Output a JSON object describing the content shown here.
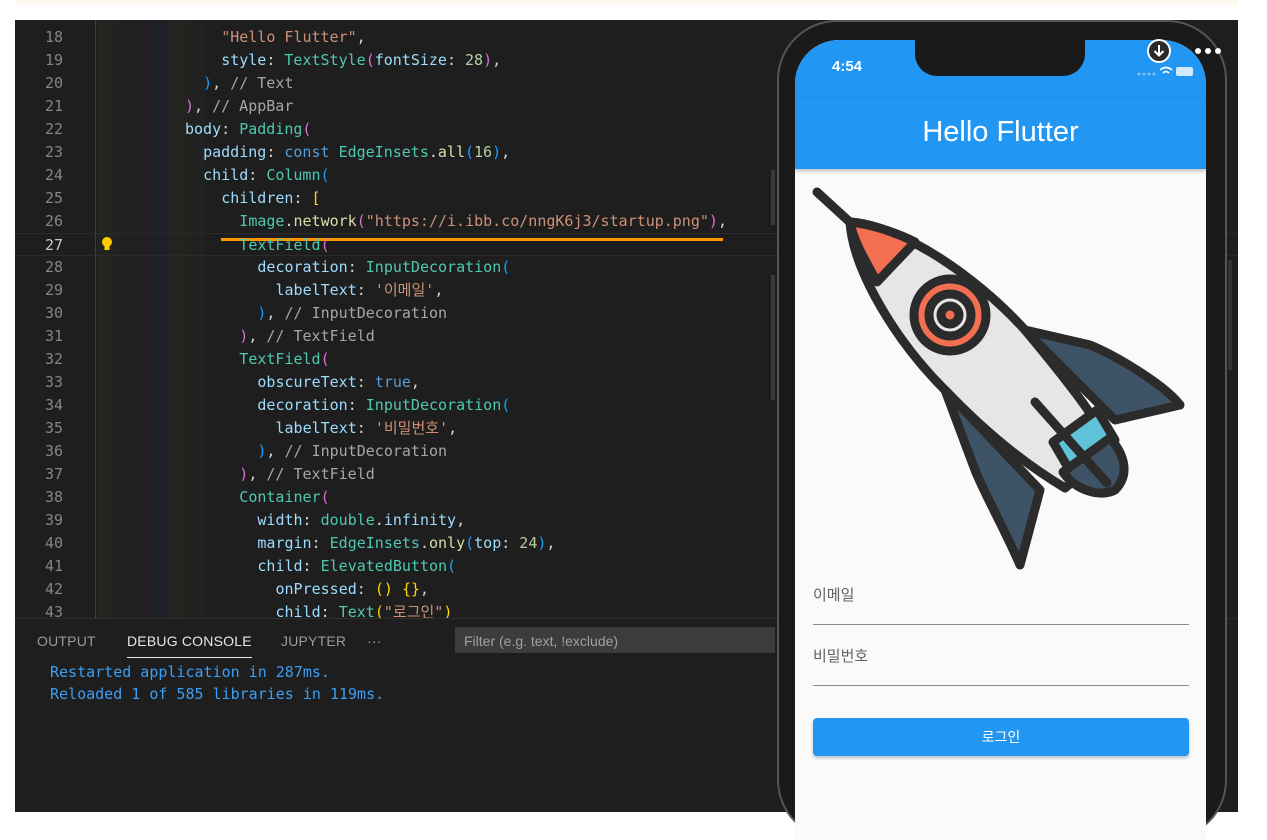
{
  "code_lines": [
    {
      "n": "18",
      "indent": 10,
      "tokens": [
        [
          "\"Hello Flutter\"",
          "c-str"
        ],
        [
          ",",
          "c-def"
        ]
      ]
    },
    {
      "n": "19",
      "indent": 10,
      "tokens": [
        [
          "style",
          "c-prop"
        ],
        [
          ": ",
          "c-def"
        ],
        [
          "TextStyle",
          "c-cls"
        ],
        [
          "(",
          "c-p1"
        ],
        [
          "fontSize",
          "c-prop"
        ],
        [
          ": ",
          "c-def"
        ],
        [
          "28",
          "c-num"
        ],
        [
          ")",
          "c-p1"
        ],
        [
          ",",
          "c-def"
        ]
      ]
    },
    {
      "n": "20",
      "indent": 9,
      "tokens": [
        [
          ")",
          "c-p2"
        ],
        [
          ", ",
          "c-def"
        ],
        [
          "// Text",
          "c-com"
        ]
      ]
    },
    {
      "n": "21",
      "indent": 8,
      "tokens": [
        [
          ")",
          "c-p1"
        ],
        [
          ", ",
          "c-def"
        ],
        [
          "// AppBar",
          "c-com"
        ]
      ]
    },
    {
      "n": "22",
      "indent": 8,
      "tokens": [
        [
          "body",
          "c-prop"
        ],
        [
          ": ",
          "c-def"
        ],
        [
          "Padding",
          "c-cls"
        ],
        [
          "(",
          "c-p1"
        ]
      ]
    },
    {
      "n": "23",
      "indent": 9,
      "tokens": [
        [
          "padding",
          "c-prop"
        ],
        [
          ": ",
          "c-def"
        ],
        [
          "const ",
          "c-kw"
        ],
        [
          "EdgeInsets",
          "c-cls"
        ],
        [
          ".",
          "c-def"
        ],
        [
          "all",
          "c-fn"
        ],
        [
          "(",
          "c-p2"
        ],
        [
          "16",
          "c-num"
        ],
        [
          ")",
          "c-p2"
        ],
        [
          ",",
          "c-def"
        ]
      ]
    },
    {
      "n": "24",
      "indent": 9,
      "tokens": [
        [
          "child",
          "c-prop"
        ],
        [
          ": ",
          "c-def"
        ],
        [
          "Column",
          "c-cls"
        ],
        [
          "(",
          "c-p2"
        ]
      ]
    },
    {
      "n": "25",
      "indent": 10,
      "tokens": [
        [
          "children",
          "c-prop"
        ],
        [
          ": ",
          "c-def"
        ],
        [
          "[",
          "c-p3"
        ]
      ]
    },
    {
      "n": "26",
      "indent": 11,
      "tokens": [
        [
          "Image",
          "c-cls"
        ],
        [
          ".",
          "c-def"
        ],
        [
          "network",
          "c-fn"
        ],
        [
          "(",
          "c-p1"
        ],
        [
          "\"https://i.ibb.co/nngK6j3/startup.png\"",
          "c-str"
        ],
        [
          ")",
          "c-p1"
        ],
        [
          ",",
          "c-def"
        ]
      ]
    },
    {
      "n": "27",
      "indent": 11,
      "tokens": [
        [
          "TextField",
          "c-cls"
        ],
        [
          "(",
          "c-p1"
        ]
      ],
      "current": true
    },
    {
      "n": "28",
      "indent": 12,
      "tokens": [
        [
          "decoration",
          "c-prop"
        ],
        [
          ": ",
          "c-def"
        ],
        [
          "InputDecoration",
          "c-cls"
        ],
        [
          "(",
          "c-p2"
        ]
      ]
    },
    {
      "n": "29",
      "indent": 13,
      "tokens": [
        [
          "labelText",
          "c-prop"
        ],
        [
          ": ",
          "c-def"
        ],
        [
          "'이메일'",
          "c-str"
        ],
        [
          ",",
          "c-def"
        ]
      ]
    },
    {
      "n": "30",
      "indent": 12,
      "tokens": [
        [
          ")",
          "c-p2"
        ],
        [
          ", ",
          "c-def"
        ],
        [
          "// InputDecoration",
          "c-com"
        ]
      ]
    },
    {
      "n": "31",
      "indent": 11,
      "tokens": [
        [
          ")",
          "c-p1"
        ],
        [
          ", ",
          "c-def"
        ],
        [
          "// TextField",
          "c-com"
        ]
      ]
    },
    {
      "n": "32",
      "indent": 11,
      "tokens": [
        [
          "TextField",
          "c-cls"
        ],
        [
          "(",
          "c-p1"
        ]
      ]
    },
    {
      "n": "33",
      "indent": 12,
      "tokens": [
        [
          "obscureText",
          "c-prop"
        ],
        [
          ": ",
          "c-def"
        ],
        [
          "true",
          "c-kw"
        ],
        [
          ",",
          "c-def"
        ]
      ]
    },
    {
      "n": "34",
      "indent": 12,
      "tokens": [
        [
          "decoration",
          "c-prop"
        ],
        [
          ": ",
          "c-def"
        ],
        [
          "InputDecoration",
          "c-cls"
        ],
        [
          "(",
          "c-p2"
        ]
      ]
    },
    {
      "n": "35",
      "indent": 13,
      "tokens": [
        [
          "labelText",
          "c-prop"
        ],
        [
          ": ",
          "c-def"
        ],
        [
          "'비밀번호'",
          "c-str"
        ],
        [
          ",",
          "c-def"
        ]
      ]
    },
    {
      "n": "36",
      "indent": 12,
      "tokens": [
        [
          ")",
          "c-p2"
        ],
        [
          ", ",
          "c-def"
        ],
        [
          "// InputDecoration",
          "c-com"
        ]
      ]
    },
    {
      "n": "37",
      "indent": 11,
      "tokens": [
        [
          ")",
          "c-p1"
        ],
        [
          ", ",
          "c-def"
        ],
        [
          "// TextField",
          "c-com"
        ]
      ]
    },
    {
      "n": "38",
      "indent": 11,
      "tokens": [
        [
          "Container",
          "c-cls"
        ],
        [
          "(",
          "c-p1"
        ]
      ]
    },
    {
      "n": "39",
      "indent": 12,
      "tokens": [
        [
          "width",
          "c-prop"
        ],
        [
          ": ",
          "c-def"
        ],
        [
          "double",
          "c-cls"
        ],
        [
          ".",
          "c-def"
        ],
        [
          "infinity",
          "c-prop"
        ],
        [
          ",",
          "c-def"
        ]
      ]
    },
    {
      "n": "40",
      "indent": 12,
      "tokens": [
        [
          "margin",
          "c-prop"
        ],
        [
          ": ",
          "c-def"
        ],
        [
          "EdgeInsets",
          "c-cls"
        ],
        [
          ".",
          "c-def"
        ],
        [
          "only",
          "c-fn"
        ],
        [
          "(",
          "c-p2"
        ],
        [
          "top",
          "c-prop"
        ],
        [
          ": ",
          "c-def"
        ],
        [
          "24",
          "c-num"
        ],
        [
          ")",
          "c-p2"
        ],
        [
          ",",
          "c-def"
        ]
      ]
    },
    {
      "n": "41",
      "indent": 12,
      "tokens": [
        [
          "child",
          "c-prop"
        ],
        [
          ": ",
          "c-def"
        ],
        [
          "ElevatedButton",
          "c-cls"
        ],
        [
          "(",
          "c-p2"
        ]
      ]
    },
    {
      "n": "42",
      "indent": 13,
      "tokens": [
        [
          "onPressed",
          "c-prop"
        ],
        [
          ": ",
          "c-def"
        ],
        [
          "()",
          "c-p3"
        ],
        [
          " ",
          "c-def"
        ],
        [
          "{}",
          "c-p3"
        ],
        [
          ",",
          "c-def"
        ]
      ]
    },
    {
      "n": "43",
      "indent": 13,
      "tokens": [
        [
          "child",
          "c-prop"
        ],
        [
          ": ",
          "c-def"
        ],
        [
          "Text",
          "c-cls"
        ],
        [
          "(",
          "c-p3"
        ],
        [
          "\"로그인\"",
          "c-str"
        ],
        [
          ")",
          "c-p3"
        ]
      ]
    }
  ],
  "panel": {
    "tabs": [
      {
        "label": "OUTPUT",
        "active": false
      },
      {
        "label": "DEBUG CONSOLE",
        "active": true
      },
      {
        "label": "JUPYTER",
        "active": false
      }
    ],
    "more_label": "···",
    "filter_placeholder": "Filter (e.g. text, !exclude)",
    "console": [
      "Restarted application in 287ms.",
      "Reloaded 1 of 585 libraries in 119ms."
    ]
  },
  "phone": {
    "time": "4:54",
    "appbar_title": "Hello Flutter",
    "email_label": "이메일",
    "password_label": "비밀번호",
    "login_label": "로그인"
  },
  "icons": {
    "bulb": "lightbulb-icon",
    "download": "download-icon",
    "more": "more-icon",
    "rocket": "rocket-image"
  },
  "colors": {
    "primary": "#2196f3",
    "highlight_underline": "#ff9500",
    "console_text": "#3b9ef5"
  }
}
